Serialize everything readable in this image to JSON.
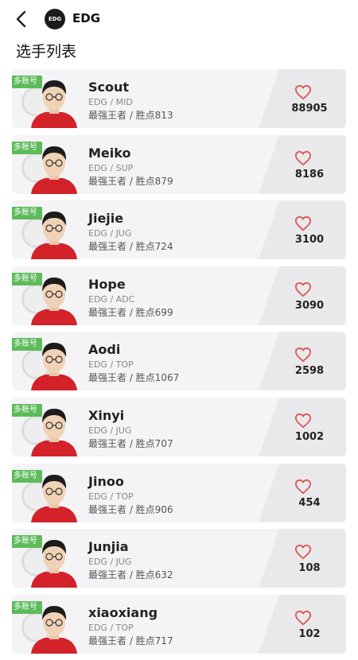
{
  "header": {
    "team_logo_text": "EDG",
    "team_name": "EDG"
  },
  "section_title": "选手列表",
  "colors": {
    "badge": "#5dbb5a",
    "heart": "#e05555",
    "jersey": "#d4222a"
  },
  "players": [
    {
      "badge": "多账号",
      "name": "Scout",
      "team_role": "EDG / MID",
      "stats": "最强王者 / 胜点813",
      "likes": "88905"
    },
    {
      "badge": "多账号",
      "name": "Meiko",
      "team_role": "EDG / SUP",
      "stats": "最强王者 / 胜点879",
      "likes": "8186"
    },
    {
      "badge": "多账号",
      "name": "Jiejie",
      "team_role": "EDG / JUG",
      "stats": "最强王者 / 胜点724",
      "likes": "3100"
    },
    {
      "badge": "多账号",
      "name": "Hope",
      "team_role": "EDG / ADC",
      "stats": "最强王者 / 胜点699",
      "likes": "3090"
    },
    {
      "badge": "多账号",
      "name": "Aodi",
      "team_role": "EDG / TOP",
      "stats": "最强王者 / 胜点1067",
      "likes": "2598"
    },
    {
      "badge": "多账号",
      "name": "Xinyi",
      "team_role": "EDG / JUG",
      "stats": "最强王者 / 胜点707",
      "likes": "1002"
    },
    {
      "badge": "多账号",
      "name": "Jinoo",
      "team_role": "EDG / TOP",
      "stats": "最强王者 / 胜点906",
      "likes": "454"
    },
    {
      "badge": "多账号",
      "name": "Junjia",
      "team_role": "EDG / JUG",
      "stats": "最强王者 / 胜点632",
      "likes": "108"
    },
    {
      "badge": "多账号",
      "name": "xiaoxiang",
      "team_role": "EDG / TOP",
      "stats": "最强王者 / 胜点717",
      "likes": "102"
    }
  ]
}
